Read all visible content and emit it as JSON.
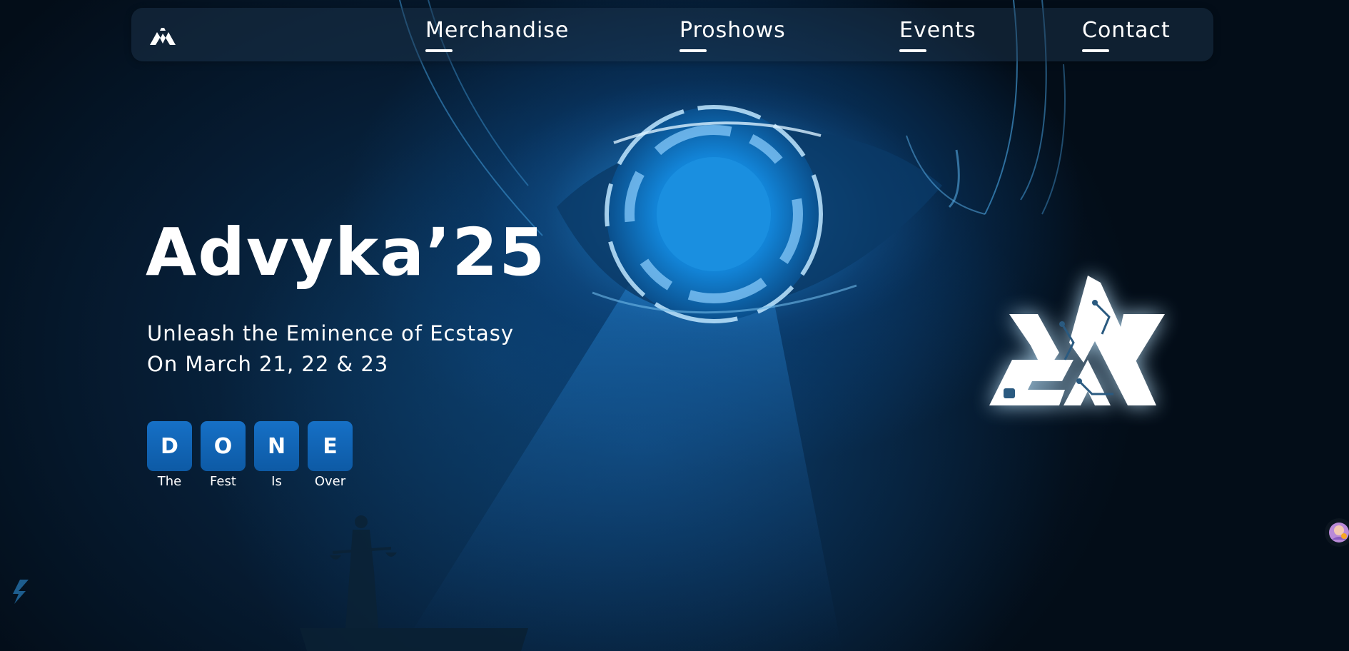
{
  "nav": {
    "logo_icon": "advyka-logo-icon",
    "items": [
      {
        "label": "Merchandise"
      },
      {
        "label": "Proshows"
      },
      {
        "label": "Events"
      },
      {
        "label": "Contact"
      }
    ]
  },
  "hero": {
    "title": "Advyka’25",
    "tagline": "Unleash the Eminence of Ecstasy",
    "dates": "On March 21, 22 & 23",
    "tiles": [
      {
        "letter": "D",
        "caption": "The"
      },
      {
        "letter": "O",
        "caption": "Fest"
      },
      {
        "letter": "N",
        "caption": "Is"
      },
      {
        "letter": "E",
        "caption": "Over"
      }
    ],
    "emblem_icon": "advyka-emblem-icon"
  },
  "colors": {
    "tile_bg": "#1670c6",
    "accent_glow": "#1478c8",
    "text": "#ffffff"
  },
  "widgets": {
    "side_icon": "lightning-badge-icon",
    "chat_icon": "assistant-avatar-icon"
  }
}
